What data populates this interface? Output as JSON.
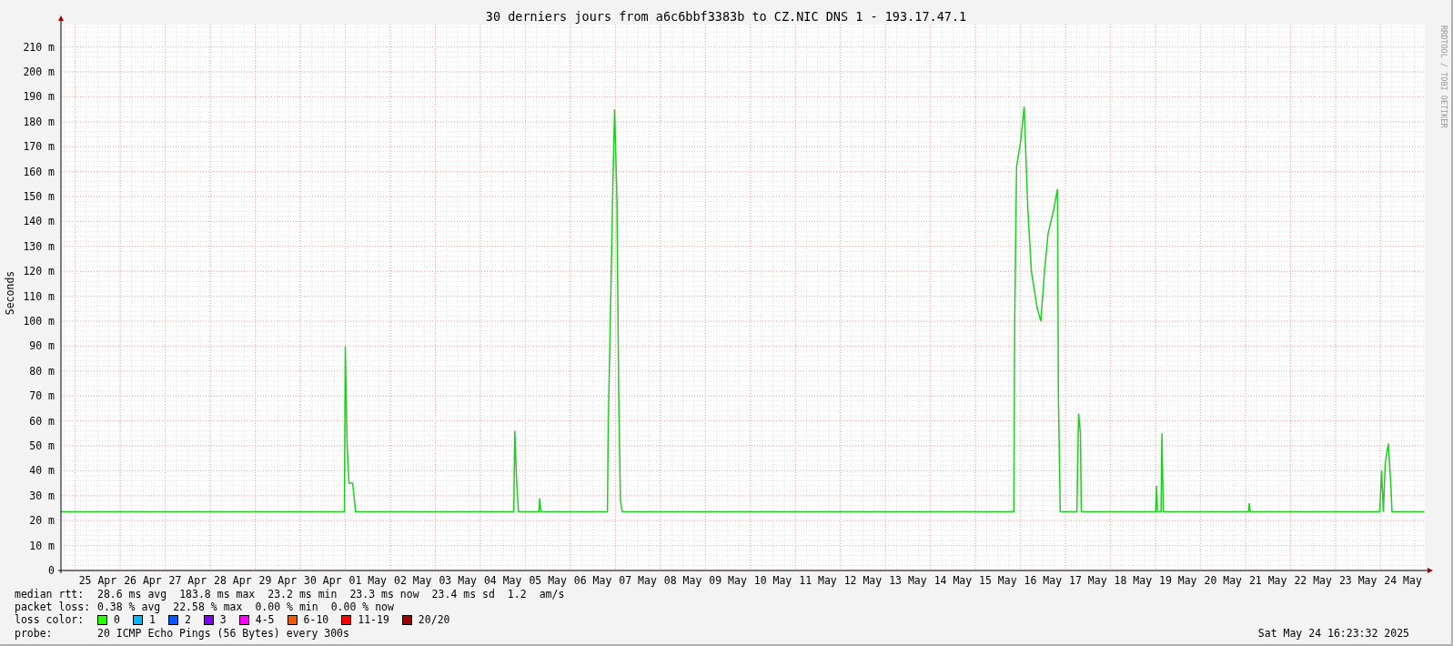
{
  "graph": {
    "chart_data": {
      "type": "line",
      "title": "30 derniers jours from a6c6bbf3383b to CZ.NIC DNS 1 - 193.17.47.1",
      "ylabel": "Seconds",
      "x": [
        "2025-04-24T16:23",
        "2025-04-30T23:29",
        "2025-04-30T23:59",
        "2025-05-01T00:58",
        "2025-05-01T01:58",
        "2025-05-01T03:55",
        "2025-05-01T04:56",
        "2025-05-01T05:25",
        "2025-05-04T17:49",
        "2025-05-04T18:21",
        "2025-05-04T19:20",
        "2025-05-04T20:21",
        "2025-05-05T07:11",
        "2025-05-05T07:42",
        "2025-05-05T08:10",
        "2025-05-06T19:45",
        "2025-05-06T20:13",
        "2025-05-06T21:40",
        "2025-05-06T22:37",
        "2025-05-06T23:35",
        "2025-05-07T00:47",
        "2025-05-07T01:45",
        "2025-05-07T02:42",
        "2025-05-07T03:40",
        "2025-05-15T20:28",
        "2025-05-15T20:57",
        "2025-05-15T21:54",
        "2025-05-16T00:04",
        "2025-05-16T01:59",
        "2025-05-16T02:57",
        "2025-05-16T03:54",
        "2025-05-16T05:49",
        "2025-05-16T08:57",
        "2025-05-16T10:52",
        "2025-05-16T12:47",
        "2025-05-16T14:42",
        "2025-05-16T17:49",
        "2025-05-16T19:45",
        "2025-05-16T20:13",
        "2025-05-16T21:11",
        "2025-05-17T06:04",
        "2025-05-17T07:01",
        "2025-05-17T07:59",
        "2025-05-17T08:28",
        "2025-05-19T00:04",
        "2025-05-19T00:33",
        "2025-05-19T01:01",
        "2025-05-19T02:57",
        "2025-05-19T03:25",
        "2025-05-19T04:09",
        "2025-05-21T01:30",
        "2025-05-21T01:59",
        "2025-05-21T02:28",
        "2025-05-23T23:35",
        "2025-05-24T00:33",
        "2025-05-24T01:30",
        "2025-05-24T02:28",
        "2025-05-24T04:09",
        "2025-05-24T05:35",
        "2025-05-24T06:04",
        "2025-05-24T23:21"
      ],
      "series": [
        {
          "color": "#22cc22",
          "values": [
            23.5,
            23.5,
            90,
            50,
            35,
            35,
            28,
            23.5,
            23.5,
            56,
            36,
            23.5,
            23.5,
            29,
            23.5,
            23.5,
            60,
            115,
            153,
            185,
            150,
            72,
            28,
            23.5,
            23.5,
            101,
            162,
            172,
            186,
            165,
            145,
            120,
            105,
            100,
            120,
            135,
            145,
            153,
            70,
            23.5,
            23.5,
            63,
            55,
            23.5,
            23.5,
            34,
            23.5,
            23.5,
            55,
            23.5,
            23.5,
            27,
            23.5,
            23.5,
            40,
            23.5,
            43,
            51,
            33,
            23.5,
            23.5
          ]
        }
      ],
      "grid": true,
      "xlim": [
        "2025-04-24T16:23",
        "2025-05-24T23:35"
      ],
      "ylim": [
        0,
        219
      ],
      "xticks": [
        {
          "value": "2025-04-25T12:00",
          "label": "25 Apr"
        },
        {
          "value": "2025-04-26T12:00",
          "label": "26 Apr"
        },
        {
          "value": "2025-04-27T12:00",
          "label": "27 Apr"
        },
        {
          "value": "2025-04-28T12:00",
          "label": "28 Apr"
        },
        {
          "value": "2025-04-29T12:00",
          "label": "29 Apr"
        },
        {
          "value": "2025-04-30T12:00",
          "label": "30 Apr"
        },
        {
          "value": "2025-05-01T12:00",
          "label": "01 May"
        },
        {
          "value": "2025-05-02T12:00",
          "label": "02 May"
        },
        {
          "value": "2025-05-03T12:00",
          "label": "03 May"
        },
        {
          "value": "2025-05-04T12:00",
          "label": "04 May"
        },
        {
          "value": "2025-05-05T12:00",
          "label": "05 May"
        },
        {
          "value": "2025-05-06T12:00",
          "label": "06 May"
        },
        {
          "value": "2025-05-07T12:00",
          "label": "07 May"
        },
        {
          "value": "2025-05-08T12:00",
          "label": "08 May"
        },
        {
          "value": "2025-05-09T12:00",
          "label": "09 May"
        },
        {
          "value": "2025-05-10T12:00",
          "label": "10 May"
        },
        {
          "value": "2025-05-11T12:00",
          "label": "11 May"
        },
        {
          "value": "2025-05-12T12:00",
          "label": "12 May"
        },
        {
          "value": "2025-05-13T12:00",
          "label": "13 May"
        },
        {
          "value": "2025-05-14T12:00",
          "label": "14 May"
        },
        {
          "value": "2025-05-15T12:00",
          "label": "15 May"
        },
        {
          "value": "2025-05-16T12:00",
          "label": "16 May"
        },
        {
          "value": "2025-05-17T12:00",
          "label": "17 May"
        },
        {
          "value": "2025-05-18T12:00",
          "label": "18 May"
        },
        {
          "value": "2025-05-19T12:00",
          "label": "19 May"
        },
        {
          "value": "2025-05-20T12:00",
          "label": "20 May"
        },
        {
          "value": "2025-05-21T12:00",
          "label": "21 May"
        },
        {
          "value": "2025-05-22T12:00",
          "label": "22 May"
        },
        {
          "value": "2025-05-23T12:00",
          "label": "23 May"
        },
        {
          "value": "2025-05-24T12:00",
          "label": "24 May"
        }
      ],
      "yticks": [
        {
          "value": 0,
          "label": "0"
        },
        {
          "value": 10,
          "label": "10 m"
        },
        {
          "value": 20,
          "label": "20 m"
        },
        {
          "value": 30,
          "label": "30 m"
        },
        {
          "value": 40,
          "label": "40 m"
        },
        {
          "value": 50,
          "label": "50 m"
        },
        {
          "value": 60,
          "label": "60 m"
        },
        {
          "value": 70,
          "label": "70 m"
        },
        {
          "value": 80,
          "label": "80 m"
        },
        {
          "value": 90,
          "label": "90 m"
        },
        {
          "value": 100,
          "label": "100 m"
        },
        {
          "value": 110,
          "label": "110 m"
        },
        {
          "value": 120,
          "label": "120 m"
        },
        {
          "value": 130,
          "label": "130 m"
        },
        {
          "value": 140,
          "label": "140 m"
        },
        {
          "value": 150,
          "label": "150 m"
        },
        {
          "value": 160,
          "label": "160 m"
        },
        {
          "value": 170,
          "label": "170 m"
        },
        {
          "value": 180,
          "label": "180 m"
        },
        {
          "value": 190,
          "label": "190 m"
        },
        {
          "value": 200,
          "label": "200 m"
        },
        {
          "value": 210,
          "label": "210 m"
        }
      ]
    },
    "side_credit": "RRDTOOL / TOBI OETIKER"
  },
  "legend": {
    "rows": [
      {
        "label": "median rtt:",
        "items": [
          "28.6 ms avg",
          "183.8 ms max",
          "23.2 ms min",
          "23.3 ms now",
          "23.4 ms sd",
          "1.2",
          "am/s"
        ]
      },
      {
        "label": "packet loss:",
        "items": [
          "0.38 % avg",
          "22.58 % max",
          "0.00 % min",
          "0.00 % now"
        ]
      }
    ],
    "loss_color": {
      "label": "loss color:",
      "items": [
        {
          "label": "0",
          "color": "#26ff00"
        },
        {
          "label": "1",
          "color": "#00b8ff"
        },
        {
          "label": "2",
          "color": "#0059ff"
        },
        {
          "label": "3",
          "color": "#7e00ff"
        },
        {
          "label": "4-5",
          "color": "#ff00ff"
        },
        {
          "label": "6-10",
          "color": "#ff5500"
        },
        {
          "label": "11-19",
          "color": "#ff0000"
        },
        {
          "label": "20/20",
          "color": "#a10000"
        }
      ]
    },
    "probe": {
      "label": "probe:",
      "text": "20 ICMP Echo Pings (56 Bytes) every 300s"
    },
    "timestamp": "Sat May 24 16:23:32 2025"
  }
}
